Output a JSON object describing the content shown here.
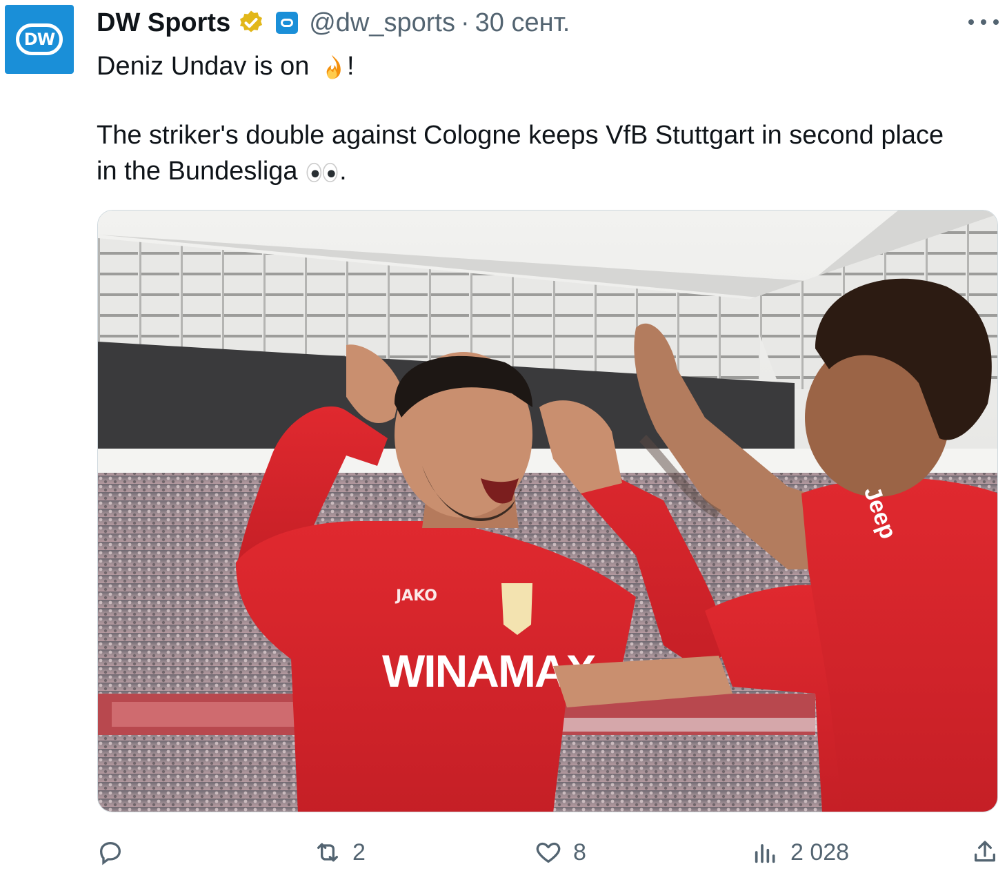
{
  "author": {
    "avatar_text": "DW",
    "name": "DW Sports",
    "handle": "@dw_sports",
    "separator": "·",
    "date": "30 сент."
  },
  "tweet": {
    "line1_text": "Deniz Undav is on ",
    "line1_emoji": "fire-emoji",
    "line1_end": "!",
    "line2": "The striker's double against Cologne keeps VfB Stuttgart in second place",
    "line3_text": "in the Bundesliga ",
    "line3_emoji": "eyes-emoji",
    "line3_end": "."
  },
  "media": {
    "jersey_brand": "JAKO",
    "jersey_sponsor": "WINAMAX"
  },
  "actions": {
    "reply_count": "",
    "retweet_count": "2",
    "like_count": "8",
    "views_count": "2 028"
  },
  "colors": {
    "accent": "#1a8fd8",
    "verified_gold": "#e2b719",
    "muted": "#536471",
    "jersey_red": "#d8262c"
  }
}
